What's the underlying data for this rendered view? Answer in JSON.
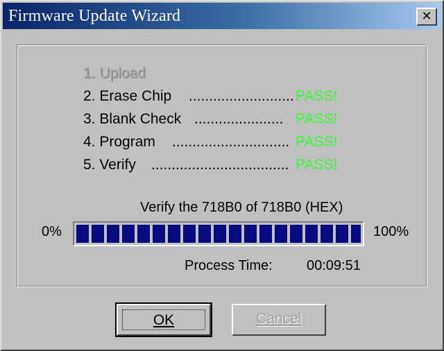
{
  "window": {
    "title": "Firmware Update Wizard",
    "close_glyph": "✕"
  },
  "steps": [
    {
      "label": "1. Upload",
      "dots": "",
      "status": "",
      "enabled": false
    },
    {
      "label": "2. Erase Chip",
      "dots": "..........................",
      "status": "PASS!",
      "enabled": true
    },
    {
      "label": "3. Blank Check",
      "dots": "......................",
      "status": "PASS!",
      "enabled": true
    },
    {
      "label": "4. Program",
      "dots": ".............................",
      "status": "PASS!",
      "enabled": true
    },
    {
      "label": "5. Verify",
      "dots": "..................................",
      "status": "PASS!",
      "enabled": true
    }
  ],
  "progress": {
    "caption": "Verify the 718B0 of 718B0 (HEX)",
    "min_label": "0%",
    "max_label": "100%",
    "percent": 100
  },
  "process": {
    "label": "Process Time:",
    "value": "00:09:51"
  },
  "buttons": {
    "ok_label": "OK",
    "cancel_label": "Cancel"
  },
  "colors": {
    "pass": "#33ff33",
    "progress_fill": "#0a0a80"
  }
}
